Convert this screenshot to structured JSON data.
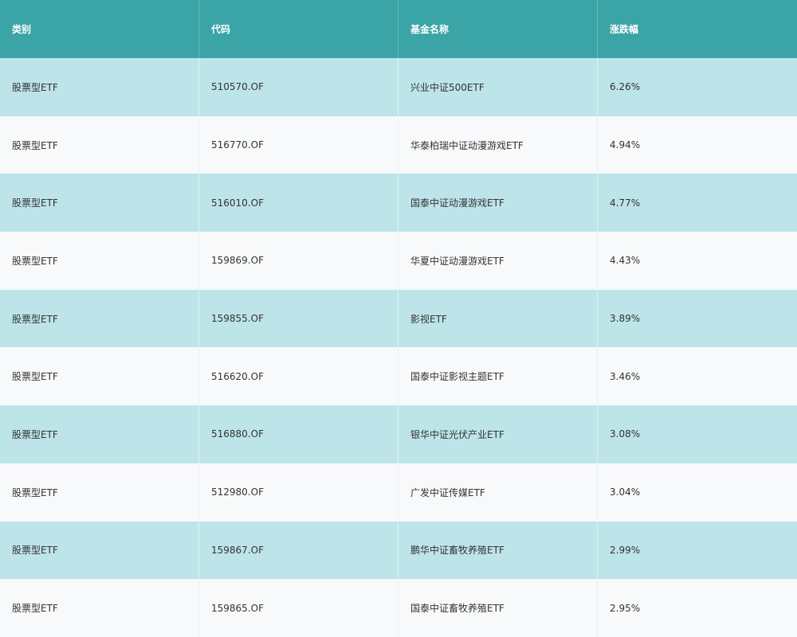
{
  "table": {
    "columns": [
      "类别",
      "代码",
      "基金名称",
      "涨跌幅"
    ],
    "rows": [
      [
        "股票型ETF",
        "510570.OF",
        "兴业中证500ETF",
        "6.26%"
      ],
      [
        "股票型ETF",
        "516770.OF",
        "华泰柏瑞中证动漫游戏ETF",
        "4.94%"
      ],
      [
        "股票型ETF",
        "516010.OF",
        "国泰中证动漫游戏ETF",
        "4.77%"
      ],
      [
        "股票型ETF",
        "159869.OF",
        "华夏中证动漫游戏ETF",
        "4.43%"
      ],
      [
        "股票型ETF",
        "159855.OF",
        "影视ETF",
        "3.89%"
      ],
      [
        "股票型ETF",
        "516620.OF",
        "国泰中证影视主题ETF",
        "3.46%"
      ],
      [
        "股票型ETF",
        "516880.OF",
        "银华中证光伏产业ETF",
        "3.08%"
      ],
      [
        "股票型ETF",
        "512980.OF",
        "广发中证传媒ETF",
        "3.04%"
      ],
      [
        "股票型ETF",
        "159867.OF",
        "鹏华中证畜牧养殖ETF",
        "2.99%"
      ],
      [
        "股票型ETF",
        "159865.OF",
        "国泰中证畜牧养殖ETF",
        "2.95%"
      ]
    ],
    "colors": {
      "header_bg": "#3ba4a6",
      "row_odd_bg": "#bde4e9",
      "row_even_bg": "#f7f9fb",
      "text": "#333333",
      "header_text": "#ffffff"
    }
  }
}
